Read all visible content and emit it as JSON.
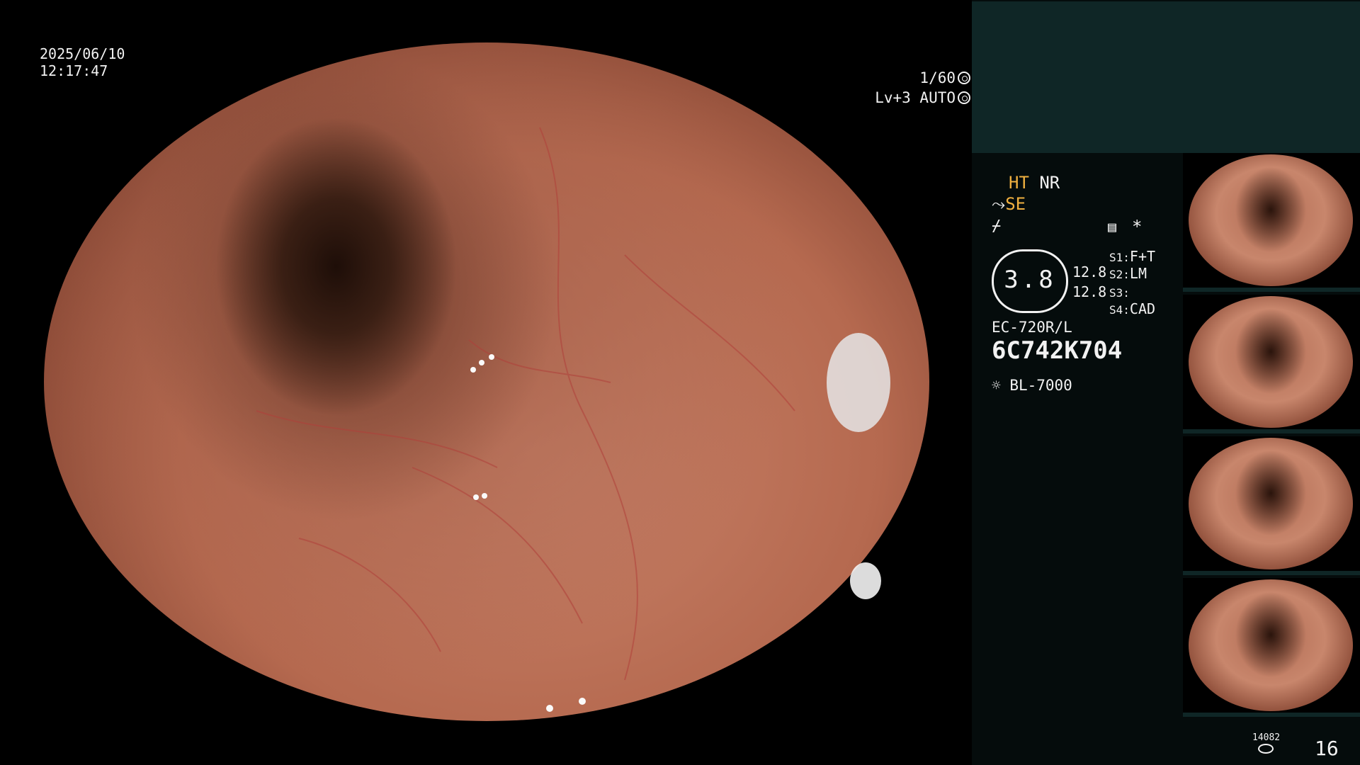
{
  "overlay": {
    "date": "2025/06/10",
    "time": "12:17:47",
    "shutter": "1/60",
    "exposure_level": "Lv+3",
    "exposure_mode": "AUTO"
  },
  "panel": {
    "mode_ht": "HT",
    "mode_nr": "NR",
    "mode_se": "SE",
    "asterisk": "*",
    "gauge_value": "3.8",
    "val_a": "12.8",
    "val_b": "12.8",
    "s1_label": "S1:",
    "s1_value": "F+T",
    "s2_label": "S2:",
    "s2_value": "LM",
    "s3_label": "S3:",
    "s3_value": "",
    "s4_label": "S4:",
    "s4_value": "CAD",
    "scope_model": "EC-720R/L",
    "scope_serial": "6C742K704",
    "light_source": "BL-7000"
  },
  "footer": {
    "image_count": "14082",
    "page_number": "16"
  },
  "colors": {
    "panel_top": "#0f2626",
    "panel_bg": "#050c0c",
    "accent_orange": "#f0b040"
  }
}
